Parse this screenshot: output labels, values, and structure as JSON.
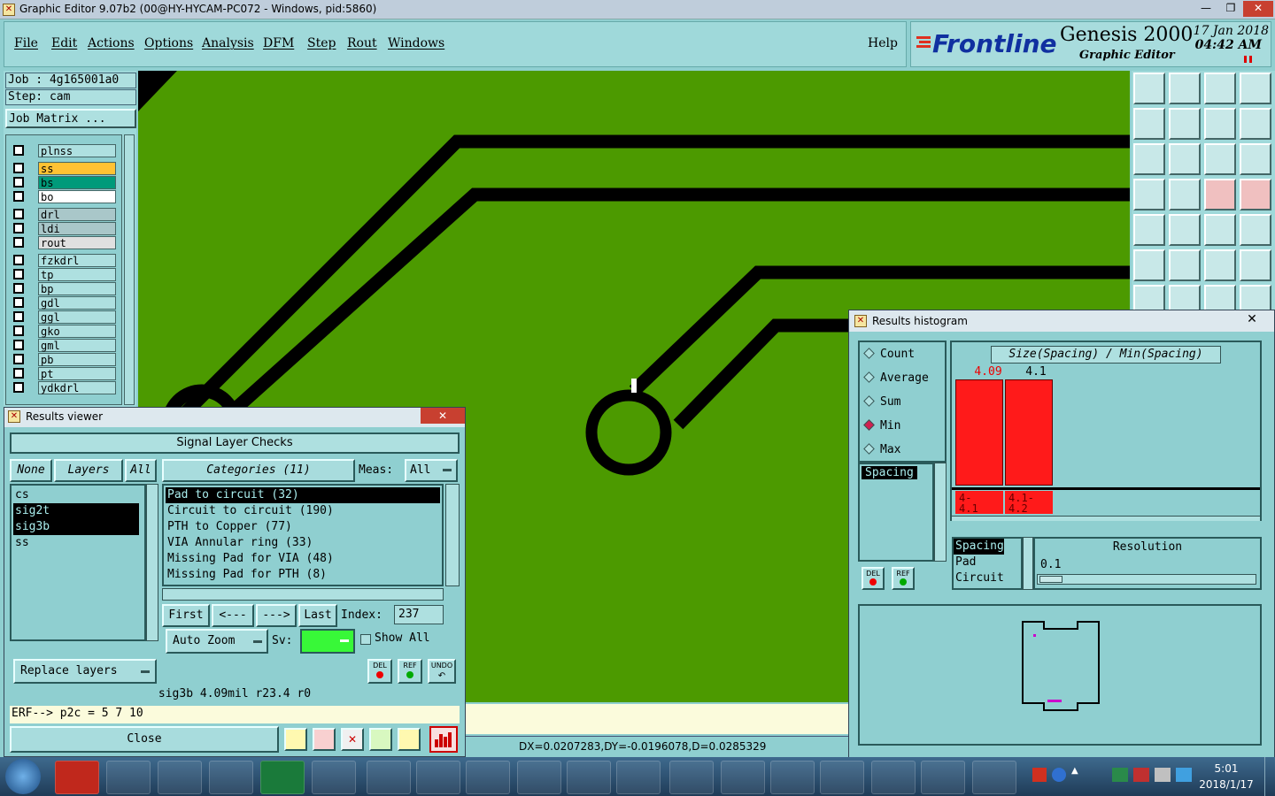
{
  "window": {
    "title": "Graphic Editor 9.07b2 (00@HY-HYCAM-PC072 - Windows, pid:5860)"
  },
  "menu": [
    "File",
    "Edit",
    "Actions",
    "Options",
    "Analysis",
    "DFM",
    "Step",
    "Rout",
    "Windows"
  ],
  "help_label": "Help",
  "brand": {
    "logo": "Frontline",
    "product": "Genesis 2000",
    "subtitle": "Graphic Editor",
    "date": "17 Jan 2018",
    "time": "04:42 AM"
  },
  "job": {
    "job": "Job : 4g165001a0",
    "step": "Step: cam",
    "matrix_btn": "Job Matrix ..."
  },
  "layers": [
    {
      "name": "plnss",
      "color": "#aee0e0"
    },
    {
      "name": "ss",
      "color": "#ffc233"
    },
    {
      "name": "bs",
      "color": "#009a7a"
    },
    {
      "name": "bo",
      "color": "#ffffff"
    },
    {
      "name": "drl",
      "color": "#a9c7c9"
    },
    {
      "name": "ldi",
      "color": "#a9c7c9"
    },
    {
      "name": "rout",
      "color": "#e0e0e0"
    },
    {
      "name": "fzkdrl",
      "color": "#aee0e0"
    },
    {
      "name": "tp",
      "color": "#aee0e0"
    },
    {
      "name": "bp",
      "color": "#aee0e0"
    },
    {
      "name": "gdl",
      "color": "#aee0e0"
    },
    {
      "name": "ggl",
      "color": "#aee0e0"
    },
    {
      "name": "gko",
      "color": "#aee0e0"
    },
    {
      "name": "gml",
      "color": "#aee0e0"
    },
    {
      "name": "pb",
      "color": "#aee0e0"
    },
    {
      "name": "pt",
      "color": "#aee0e0"
    },
    {
      "name": "ydkdrl",
      "color": "#aee0e0"
    }
  ],
  "results_viewer": {
    "title": "Results viewer",
    "heading": "Signal Layer Checks",
    "none_btn": "None",
    "layers_btn": "Layers",
    "all_btn": "All",
    "categories_btn": "Categories (11)",
    "meas_label": "Meas:",
    "meas_value": "All",
    "layer_list": [
      "cs",
      "sig2t",
      "sig3b",
      "ss"
    ],
    "categories": [
      "Pad to circuit (32)",
      "Circuit to circuit (190)",
      "PTH to Copper (77)",
      "VIA Annular ring (33)",
      "Missing Pad for VIA (48)",
      "Missing Pad for PTH (8)"
    ],
    "nav": {
      "first": "First",
      "prev": "<---",
      "next": "--->",
      "last": "Last",
      "index_label": "Index:",
      "index_value": "237"
    },
    "auto_zoom": "Auto Zoom",
    "sv_label": "Sv:",
    "show_all": "Show All",
    "replace_layers": "Replace layers",
    "del": "DEL",
    "ref": "REF",
    "undo": "UNDO",
    "status": "sig3b 4.09mil  r23.4  r0",
    "erf": "ERF--> p2c = 5 7 10",
    "close": "Close"
  },
  "histogram": {
    "title": "Results histogram",
    "modes": [
      "Count",
      "Average",
      "Sum",
      "Min",
      "Max"
    ],
    "selected_mode": "Min",
    "chart_title": "Size(Spacing) / Min(Spacing)",
    "bars": [
      {
        "value_label": "4.09",
        "range": "4-\n4.1"
      },
      {
        "value_label": "4.1",
        "range": "4.1-\n4.2"
      }
    ],
    "left_list": [
      "Spacing"
    ],
    "types": [
      "Spacing",
      "Pad",
      "Circuit"
    ],
    "resolution_label": "Resolution",
    "resolution_value": "0.1",
    "del": "DEL",
    "ref": "REF"
  },
  "coords": "DX=0.0207283,DY=-0.0196078,D=0.0285329",
  "taskbar": {
    "time": "5:01",
    "date": "2018/1/17"
  },
  "colors": {
    "canvas": "#4c9a00",
    "panel": "#9fd9da",
    "bar": "#ff1a1a",
    "trace": "#000000"
  }
}
